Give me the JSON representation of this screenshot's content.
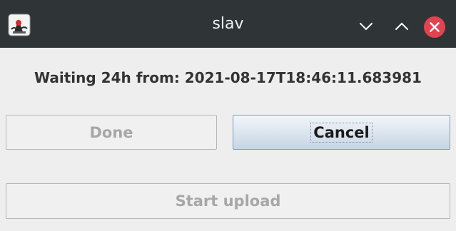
{
  "window": {
    "title": "slav",
    "icons": {
      "app": "java-duke-icon",
      "minimize": "chevron-down-icon",
      "maximize": "chevron-up-icon",
      "close": "close-icon"
    },
    "colors": {
      "titlebar": "#2f3437",
      "close": "#e5424f",
      "background": "#eeeeee"
    }
  },
  "dialog": {
    "status_text": "Waiting 24h from: 2021-08-17T18:46:11.683981",
    "done_label": "Done",
    "cancel_label": "Cancel",
    "upload_label": "Start upload"
  }
}
